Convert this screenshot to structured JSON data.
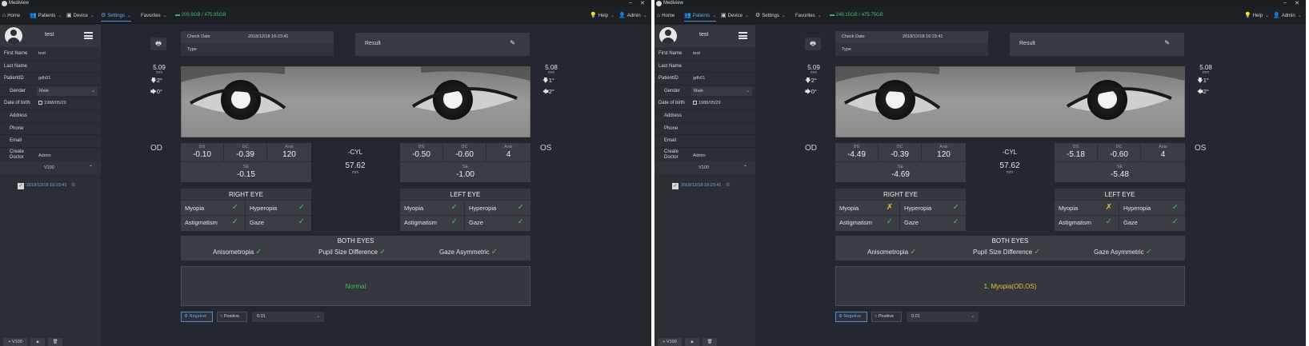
{
  "colors": {
    "accent": "#4a90d9",
    "ok": "#3fbf4f",
    "warning": "#e8c23a",
    "normal_text": "#3fbf4f",
    "abnormal_text": "#e8c23a"
  },
  "window": {
    "title": "Mediview"
  },
  "menu": {
    "home": "Home",
    "patients": "Patients",
    "device": "Device",
    "settings": "Settings",
    "favorites": "Favorites",
    "help": "Help",
    "admin": "Admin"
  },
  "panes": [
    {
      "storage": "209.9GB / 475.95GB",
      "active_menu": "settings",
      "profile": {
        "name": "test"
      },
      "fields": {
        "first_name_label": "First Name",
        "first_name": "test",
        "last_name_label": "Last Name",
        "last_name": "",
        "patient_id_label": "PatientID",
        "patient_id": "gdh01",
        "gender_label": "Gender",
        "gender": "Male",
        "dob_label": "Date of birth",
        "dob": "1988/05/29",
        "address_label": "Address",
        "phone_label": "Phone",
        "email_label": "Email",
        "doctor_label_1": "Create",
        "doctor_label_2": "Doctor",
        "doctor": "Admin"
      },
      "visit_header": "V100",
      "visit_date": "2018/12/18 16:23:41",
      "bottom_buttons": {
        "add": "+ V100",
        "up": "▲",
        "delete": "🗑"
      },
      "check_date_label": "Check Date",
      "check_date": "2018/12/18 16:23:41",
      "type_label": "Type",
      "result_label": "Result",
      "od": {
        "pupil_mm": "5.09",
        "unit": "mm",
        "arrow1": "2°",
        "arrow2": "0°",
        "ds": "-0.10",
        "dc": "-0.39",
        "axis": "120",
        "se": "-0.15"
      },
      "os": {
        "pupil_mm": "5.08",
        "unit": "mm",
        "arrow1": "1°",
        "arrow2": "2°",
        "ds": "-0.50",
        "dc": "-0.60",
        "axis": "4",
        "se": "-1.00"
      },
      "headers": {
        "ds": "DS",
        "dc": "DC",
        "axis": "Axis",
        "se": "SE"
      },
      "od_label": "OD",
      "os_label": "OS",
      "cyl_label": "-CYL",
      "cyl_value": "57.62",
      "cyl_unit": "mm",
      "right_eye_title": "RIGHT EYE",
      "left_eye_title": "LEFT EYE",
      "checks": {
        "myopia": "Myopia",
        "hyperopia": "Hyperopia",
        "astigmatism": "Astigmatism",
        "gaze": "Gaze"
      },
      "right_marks": {
        "myopia": "✓",
        "hyperopia": "✓",
        "astigmatism": "✓",
        "gaze": "✓"
      },
      "left_marks": {
        "myopia": "✓",
        "hyperopia": "✓",
        "astigmatism": "✓",
        "gaze": "✓"
      },
      "both_title": "BOTH EYES",
      "both": {
        "anisometropia": "Anisometropia",
        "pupil_size": "Pupil Size Difference",
        "gaze_asym": "Gaze Asymmetric"
      },
      "both_marks": {
        "anisometropia": "✓",
        "pupil_size": "✓",
        "gaze_asym": "✓"
      },
      "summary": "Normal",
      "summary_status": "normal",
      "mode": {
        "negative": "Negative",
        "positive": "Positive",
        "step": "0.01"
      }
    },
    {
      "storage": "249.15GB / 475.75GB",
      "active_menu": "patients",
      "profile": {
        "name": "test"
      },
      "fields": {
        "first_name_label": "First Name",
        "first_name": "test",
        "last_name_label": "Last Name",
        "last_name": "",
        "patient_id_label": "PatientID",
        "patient_id": "gdh01",
        "gender_label": "Gender",
        "gender": "Male",
        "dob_label": "Date of birth",
        "dob": "1988/05/29",
        "address_label": "Address",
        "phone_label": "Phone",
        "email_label": "Email",
        "doctor_label_1": "Create",
        "doctor_label_2": "Doctor",
        "doctor": "Admin"
      },
      "visit_header": "V100",
      "visit_date": "2018/12/18 16:23:41",
      "bottom_buttons": {
        "add": "+ V100",
        "up": "▲",
        "delete": "🗑"
      },
      "check_date_label": "Check Date",
      "check_date": "2018/12/18 16:23:41",
      "type_label": "Type",
      "result_label": "Result",
      "od": {
        "pupil_mm": "5.09",
        "unit": "mm",
        "arrow1": "2°",
        "arrow2": "0°",
        "ds": "-4.49",
        "dc": "-0.39",
        "axis": "120",
        "se": "-4.69"
      },
      "os": {
        "pupil_mm": "5.08",
        "unit": "mm",
        "arrow1": "1°",
        "arrow2": "2°",
        "ds": "-5.18",
        "dc": "-0.60",
        "axis": "4",
        "se": "-5.48"
      },
      "headers": {
        "ds": "DS",
        "dc": "DC",
        "axis": "Axis",
        "se": "SE"
      },
      "od_label": "OD",
      "os_label": "OS",
      "cyl_label": "-CYL",
      "cyl_value": "57.62",
      "cyl_unit": "mm",
      "right_eye_title": "RIGHT EYE",
      "left_eye_title": "LEFT EYE",
      "checks": {
        "myopia": "Myopia",
        "hyperopia": "Hyperopia",
        "astigmatism": "Astigmatism",
        "gaze": "Gaze"
      },
      "right_marks": {
        "myopia": "✗",
        "hyperopia": "✓",
        "astigmatism": "✓",
        "gaze": "✓"
      },
      "left_marks": {
        "myopia": "✗",
        "hyperopia": "✓",
        "astigmatism": "✓",
        "gaze": "✓"
      },
      "both_title": "BOTH EYES",
      "both": {
        "anisometropia": "Anisometropia",
        "pupil_size": "Pupil Size Difference",
        "gaze_asym": "Gaze Asymmetric"
      },
      "both_marks": {
        "anisometropia": "✓",
        "pupil_size": "✓",
        "gaze_asym": "✓"
      },
      "summary": "1. Myopia(OD,OS)",
      "summary_status": "abnormal",
      "mode": {
        "negative": "Negative",
        "positive": "Positive",
        "step": "0.01"
      }
    }
  ]
}
